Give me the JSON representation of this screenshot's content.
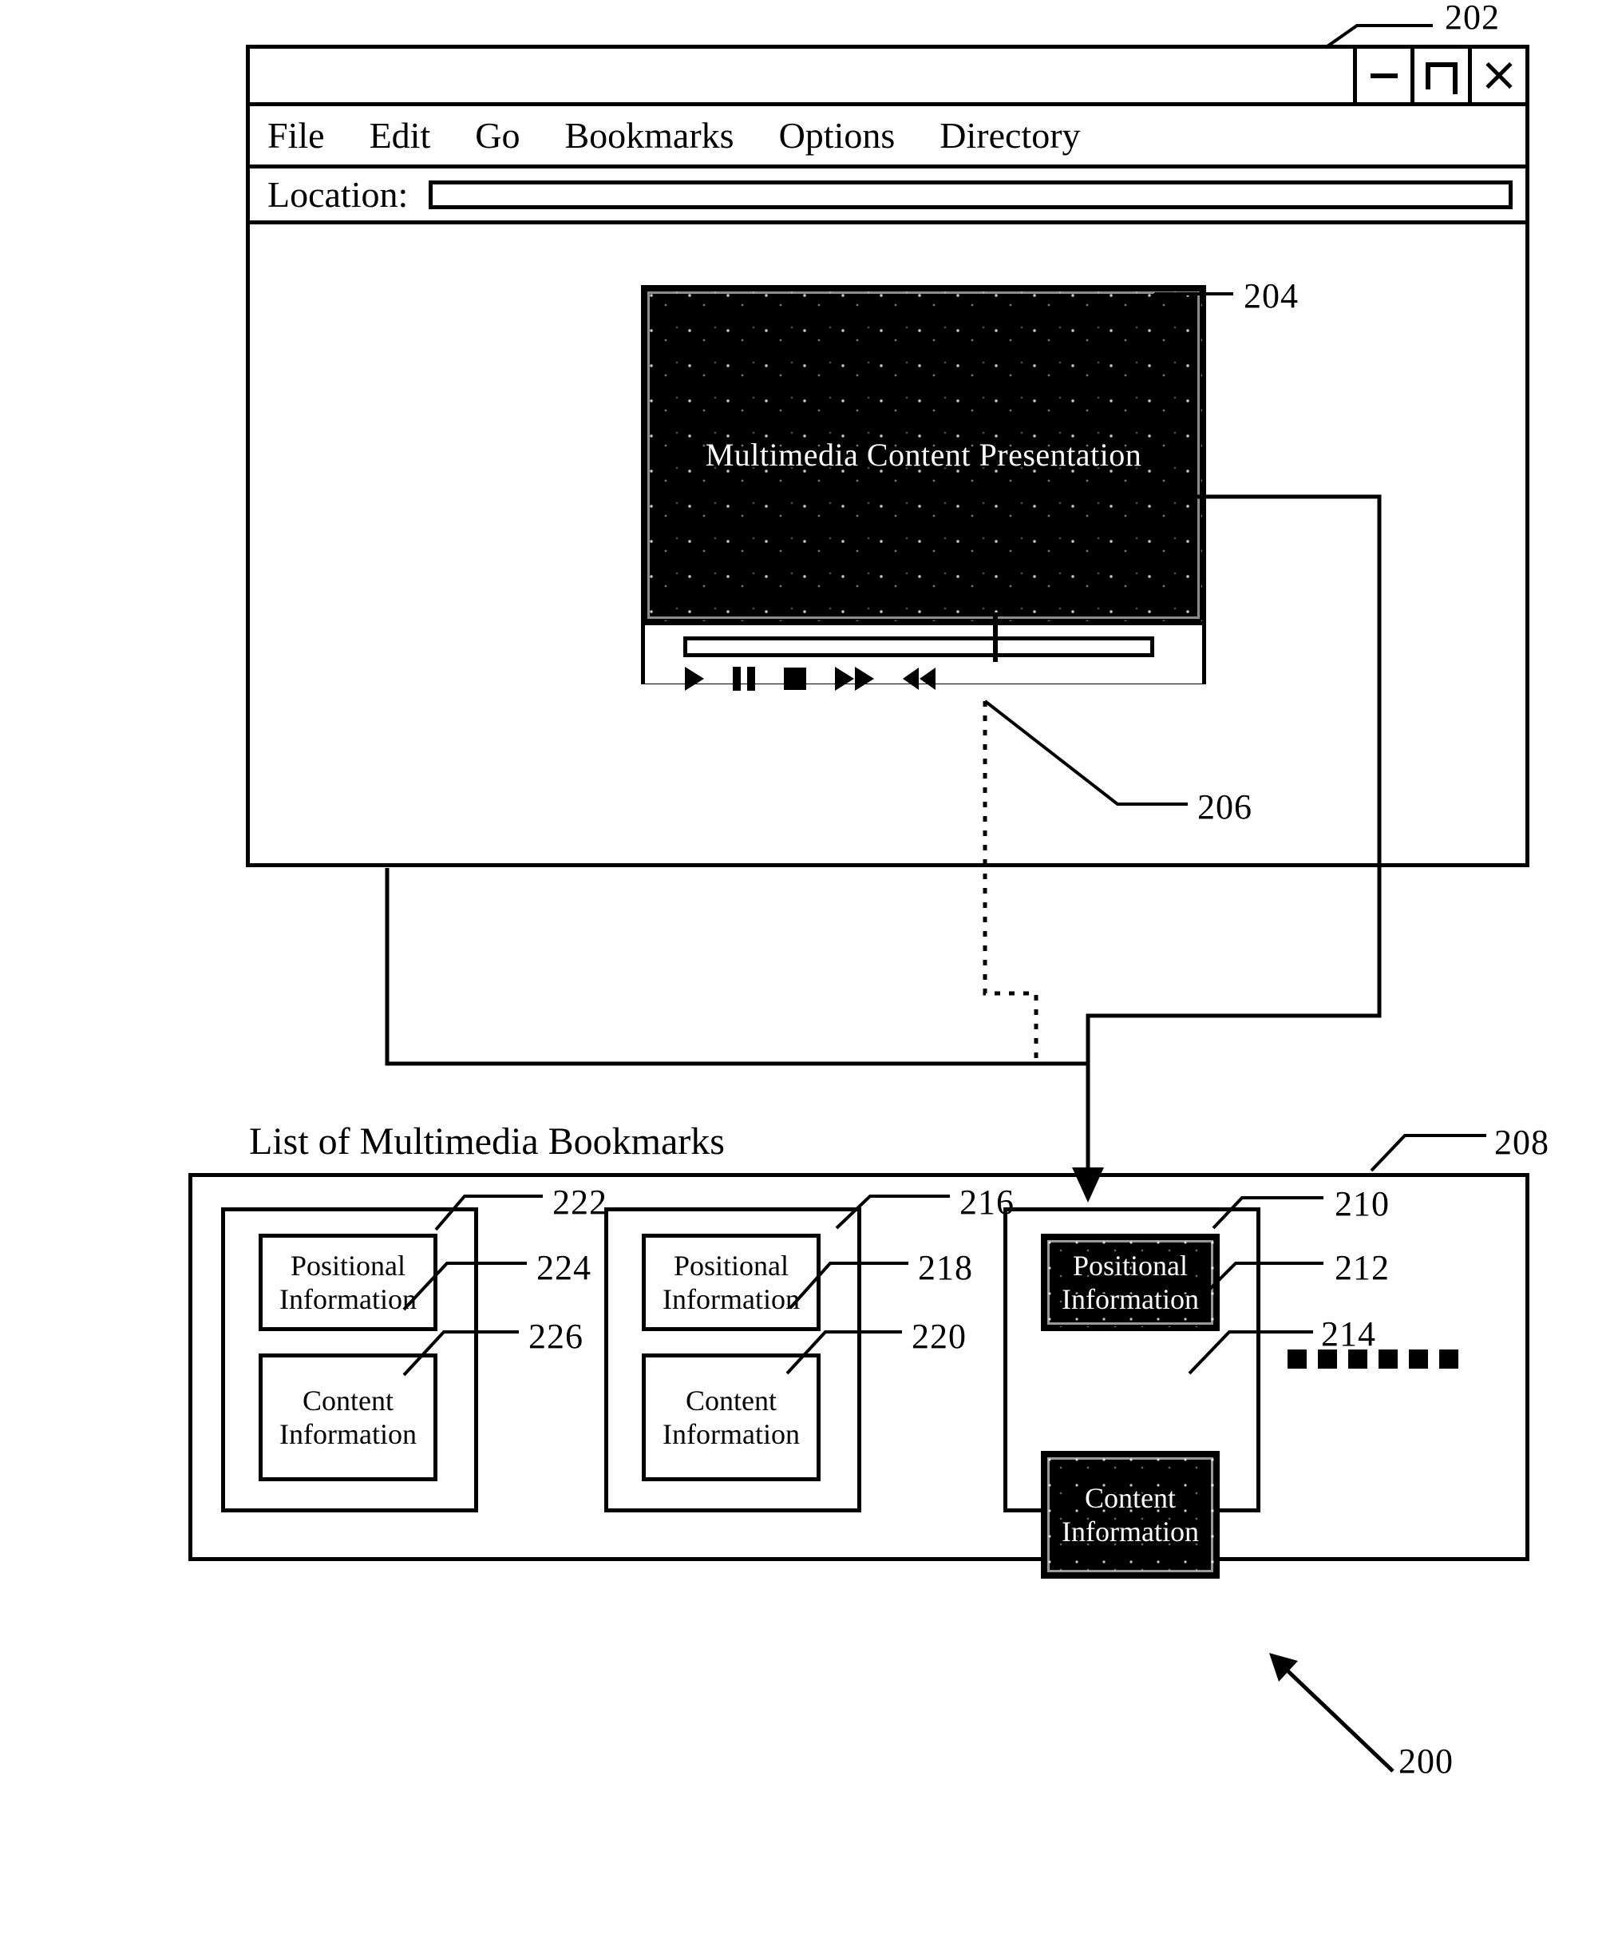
{
  "figure": {
    "ref_200": "200",
    "ref_202": "202",
    "ref_204": "204",
    "ref_206": "206",
    "ref_208": "208",
    "ref_210": "210",
    "ref_212": "212",
    "ref_214": "214",
    "ref_216": "216",
    "ref_218": "218",
    "ref_220": "220",
    "ref_222": "222",
    "ref_224": "224",
    "ref_226": "226"
  },
  "browser": {
    "window_controls": {
      "minimize": "minimize-icon",
      "maximize": "maximize-icon",
      "close": "close-icon"
    },
    "menu": [
      {
        "label": "File"
      },
      {
        "label": "Edit"
      },
      {
        "label": "Go"
      },
      {
        "label": "Bookmarks"
      },
      {
        "label": "Options"
      },
      {
        "label": "Directory"
      }
    ],
    "location": {
      "label": "Location:",
      "value": "",
      "placeholder": ""
    }
  },
  "player": {
    "video_title": "Multimedia Content Presentation",
    "progress": {
      "value_percent": 74,
      "marker_label": "position-marker"
    },
    "transport": [
      {
        "name": "play-button",
        "icon": "play-icon"
      },
      {
        "name": "pause-button",
        "icon": "pause-icon"
      },
      {
        "name": "stop-button",
        "icon": "stop-icon"
      },
      {
        "name": "fast-forward-button",
        "icon": "fast-forward-icon"
      },
      {
        "name": "rewind-button",
        "icon": "rewind-icon"
      }
    ]
  },
  "bookmarks": {
    "heading": "List of Multimedia Bookmarks",
    "more_indicator_count": 6,
    "cards": [
      {
        "id": "bookmark-1",
        "selected": false,
        "positional_label": "Positional Information",
        "content_label": "Content Information"
      },
      {
        "id": "bookmark-2",
        "selected": false,
        "positional_label": "Positional Information",
        "content_label": "Content Information"
      },
      {
        "id": "bookmark-3",
        "selected": true,
        "positional_label": "Positional Information",
        "content_label": "Content Information"
      }
    ]
  },
  "colors": {
    "ink": "#000000",
    "paper": "#ffffff",
    "inverted_fill": "#000000",
    "inverted_text": "#ffffff"
  }
}
